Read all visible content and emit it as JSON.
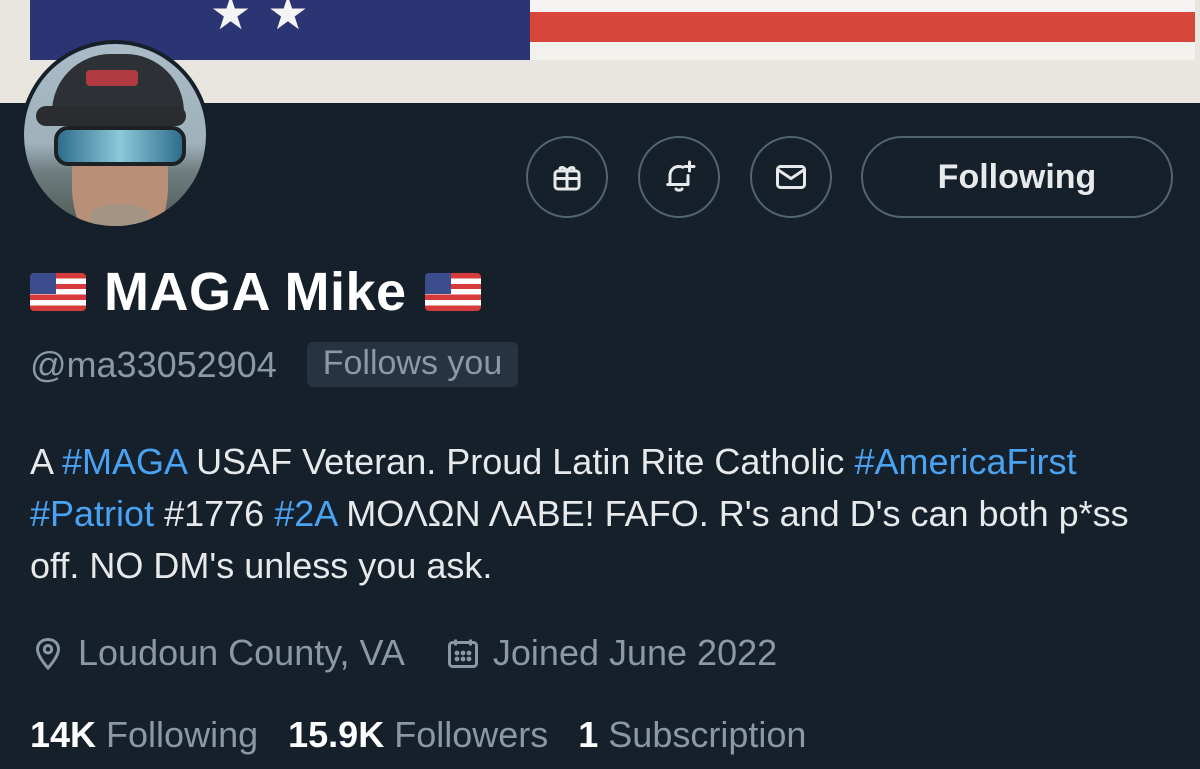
{
  "profile": {
    "display_name": "MAGA Mike",
    "handle": "@ma33052904",
    "follows_you_badge": "Follows you",
    "name_emoji": "us-flag-emoji"
  },
  "actions": {
    "gift_icon": "gift-icon",
    "notify_icon": "bell-plus-icon",
    "message_icon": "envelope-icon",
    "follow_label": "Following"
  },
  "bio": {
    "p1": "A ",
    "t1": "#MAGA",
    "p2": " USAF Veteran. Proud Latin Rite Catholic ",
    "t2": "#AmericaFirst",
    "p3": " ",
    "t3": "#Patriot",
    "p4": " #1776 ",
    "t4": "#2A",
    "p5": " ΜΟΛΩΝ ΛΑΒΕ! FAFO. R's and D's can both p*ss off. NO DM's unless you ask."
  },
  "meta": {
    "location": "Loudoun County, VA",
    "joined": "Joined June 2022"
  },
  "stats": {
    "following_count": "14K",
    "following_label": "Following",
    "followers_count": "15.9K",
    "followers_label": "Followers",
    "subscription_count": "1",
    "subscription_label": "Subscription"
  },
  "colors": {
    "background": "#15202b",
    "hashtag": "#4aa2f2",
    "muted_text": "#8b98a5",
    "button_border": "#536471"
  }
}
